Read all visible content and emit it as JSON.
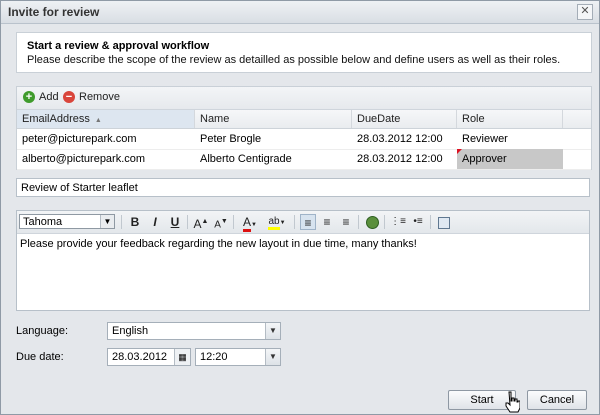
{
  "window": {
    "title": "Invite for review",
    "close_glyph": "✕"
  },
  "intro": {
    "heading": "Start a review & approval workflow",
    "description": "Please describe the scope of the review as detailled as possible below and define users as well as their roles."
  },
  "grid": {
    "toolbar": {
      "add_label": "Add",
      "remove_label": "Remove",
      "add_icon": "add-icon",
      "remove_icon": "remove-icon"
    },
    "columns": [
      "EmailAddress",
      "Name",
      "DueDate",
      "Role"
    ],
    "sort_indicator": "▲",
    "rows": [
      {
        "email": "peter@picturepark.com",
        "name": "Peter Brogle",
        "due": "28.03.2012 12:00",
        "role": "Reviewer"
      },
      {
        "email": "alberto@picturepark.com",
        "name": "Alberto Centigrade",
        "due": "28.03.2012 12:00",
        "role": "Approver"
      }
    ]
  },
  "subject": {
    "value": "Review of Starter leaflet"
  },
  "editor": {
    "font": "Tahoma",
    "toolbar": {
      "bold": "B",
      "italic": "I",
      "underline": "U",
      "grow": "A",
      "shrink": "A",
      "font_color": "A",
      "highlight": "ab"
    },
    "body": "Please provide your feedback regarding the new layout in due time, many thanks!"
  },
  "form": {
    "language_label": "Language:",
    "language_value": "English",
    "due_label": "Due date:",
    "due_date": "28.03.2012",
    "due_time": "12:20"
  },
  "buttons": {
    "start": "Start",
    "cancel": "Cancel"
  },
  "colors": {
    "accent": "#3f9b2c",
    "danger": "#d9453b",
    "selected_cell": "#c8c8c8"
  }
}
